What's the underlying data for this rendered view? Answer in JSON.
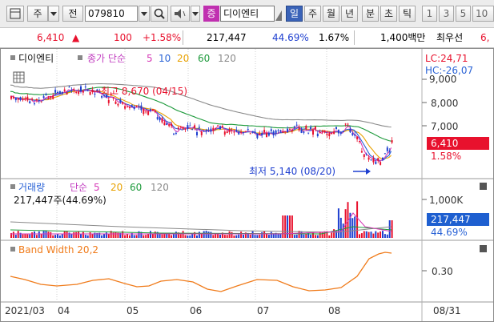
{
  "toolbar": {
    "type_label": "주",
    "period_label": "전",
    "stock_code": "079810",
    "grade_badge": "증",
    "stock_name": "디이엔티",
    "tabs": [
      "일",
      "주",
      "월",
      "년",
      "분",
      "초",
      "틱"
    ],
    "selected_tab": "일",
    "intervals": [
      "1",
      "3",
      "5",
      "10"
    ]
  },
  "quote": {
    "price": "6,410",
    "change_arrow": "▲",
    "change": "100",
    "change_pct": "+1.58%",
    "volume": "217,447",
    "volume_ratio": "44.69%",
    "turnover": "1.67%",
    "amount": "1,400백만",
    "trader": "최우선",
    "trader_value": "6,"
  },
  "price_panel": {
    "stock_name": "디이엔티",
    "ma_label": "종가 단순",
    "ma_periods": [
      "5",
      "10",
      "20",
      "60",
      "120"
    ],
    "lc": "LC:24,71",
    "hc": "HC:-26,07",
    "y_ticks": [
      "9,000",
      "8,000",
      "7,000"
    ],
    "current_price": "6,410",
    "current_pct": "1.58%",
    "high_note": "최고 8,670 (04/15)",
    "low_note": "최저 5,140 (08/20)"
  },
  "volume_panel": {
    "title": "거래량",
    "ma_label": "단순",
    "ma_periods": [
      "5",
      "20",
      "60",
      "120"
    ],
    "current": "217,447주(44.69%)",
    "y_tick": "1,000K",
    "badge_value": "217,447",
    "badge_pct": "44.69%"
  },
  "band_panel": {
    "title": "Band Width 20,2",
    "y_tick": "0.30"
  },
  "x_axis": {
    "labels": [
      "2021/03",
      "04",
      "05",
      "06",
      "07",
      "08"
    ],
    "end_label": "08/31"
  },
  "colors": {
    "up": "#e8112d",
    "down": "#1e3fd0",
    "ma5": "#d63bb7",
    "ma10": "#2a63d6",
    "ma20": "#e8a100",
    "ma60": "#1d9a3b",
    "ma120": "#8a8a8a",
    "band": "#f07b1a"
  }
}
